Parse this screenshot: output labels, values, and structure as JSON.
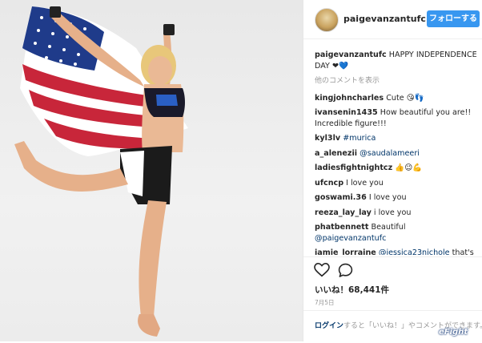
{
  "post": {
    "username": "paigevanzantufc",
    "follow_label": "フォローする",
    "caption_user": "paigevanzantufc",
    "caption_text": "HAPPY INDEPENDENCE DAY ❤💙",
    "more_comments": "他のコメントを表示",
    "comments": [
      {
        "user": "kingjohncharles",
        "text": "Cute 😘👣"
      },
      {
        "user": "ivansenin1435",
        "text": "How beautiful you are!! Incredible figure!!!"
      },
      {
        "user": "kyl3lv",
        "mention": "#murica",
        "text": ""
      },
      {
        "user": "a_alenezii",
        "mention": "@saudalameeri",
        "text": ""
      },
      {
        "user": "ladiesfightnightcz",
        "text": "👍😉💪"
      },
      {
        "user": "ufcncp",
        "text": "I love you"
      },
      {
        "user": "goswami.36",
        "text": "I love you"
      },
      {
        "user": "reeza_lay_lay",
        "text": "i love you"
      },
      {
        "user": "phatbennett",
        "text": "Beautiful",
        "mention": "@paigevanzantufc"
      },
      {
        "user": "jamie_lorraine",
        "mention": "@jessica23nichole",
        "text": "that's who's fighting lol"
      }
    ],
    "likes_text": "いいね！68,441件",
    "date": "7月5日",
    "login_link": "ログイン",
    "login_text": "すると「いいね！」やコメントができます。"
  },
  "watermark": "eFight",
  "colors": {
    "accent": "#3897f0",
    "link": "#003569",
    "muted": "#999999"
  }
}
